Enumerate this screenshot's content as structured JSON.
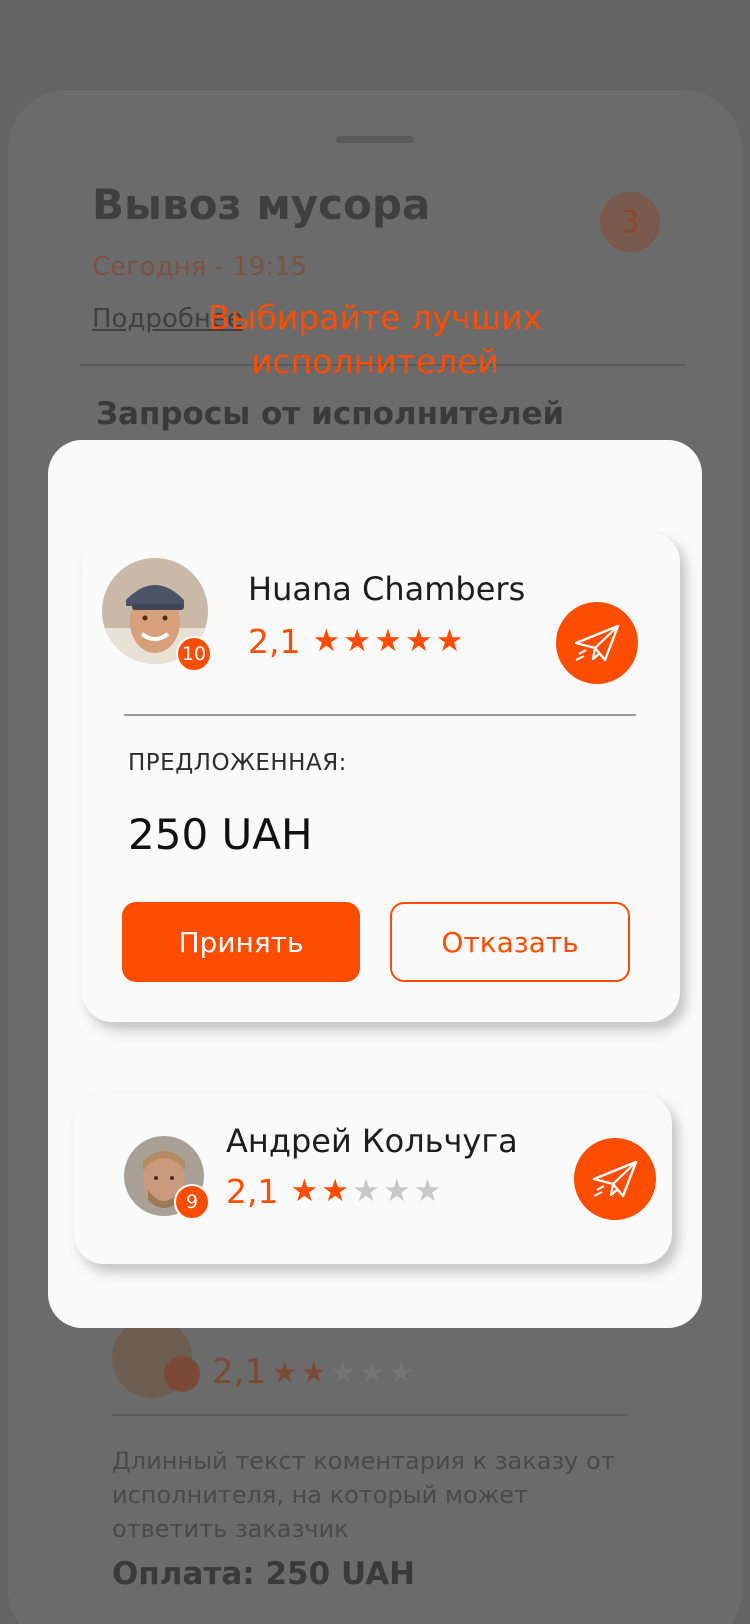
{
  "background": {
    "order_title": "Вывоз мусора",
    "order_date": "Сегодня - 19:15",
    "details_link": "Подробнее",
    "requests_badge": "3",
    "requests_title": "Запросы от исполнителей",
    "third_offer": {
      "rating": "2,1",
      "stars_filled": 2,
      "stars_total": 5,
      "comment": "Длинный текст коментария к заказу от исполнителя, на который может ответить заказчик",
      "payment": "Оплата: 250 UAH"
    }
  },
  "hint": {
    "title_line1": "Выбирайте лучших",
    "title_line2": "исполнителей"
  },
  "offers": [
    {
      "name": "Huana Chambers",
      "rating": "2,1",
      "stars_filled": 5,
      "stars_total": 5,
      "badge_count": "10",
      "offer_label": "ПРЕДЛОЖЕННАЯ:",
      "price": "250 UAH",
      "accept_label": "Принять",
      "decline_label": "Отказать"
    },
    {
      "name": "Андрей Кольчуга",
      "rating": "2,1",
      "stars_filled": 2,
      "stars_total": 5,
      "badge_count": "9"
    }
  ],
  "colors": {
    "accent": "#ff4d00",
    "overlay": "#646464",
    "card": "#fafafa",
    "star_off": "#c8c8c8"
  }
}
